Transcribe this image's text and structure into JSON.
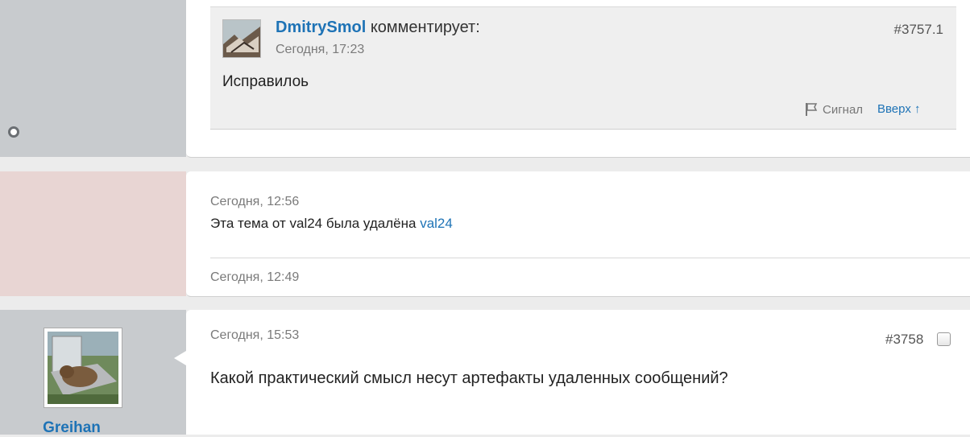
{
  "comment": {
    "author": "DmitrySmol",
    "verb": "комментирует:",
    "time": "Сегодня, 17:23",
    "number": "#3757.1",
    "text": "Исправилоь",
    "report_label": "Сигнал",
    "top_label": "Вверх ↑"
  },
  "deleted_notice": {
    "time": "Сегодня, 12:56",
    "text": "Эта тема от val24 была удалёна",
    "by_user": "val24",
    "time2": "Сегодня, 12:49"
  },
  "post": {
    "username": "Greihan",
    "time": "Сегодня, 15:53",
    "number": "#3758",
    "text": "Какой практический смысл несут артефакты удаленных сообщений?"
  },
  "colors": {
    "link": "#1e73b6",
    "sidebar": "#c8cbce",
    "deleted_sidebar": "#e8d5d3"
  }
}
